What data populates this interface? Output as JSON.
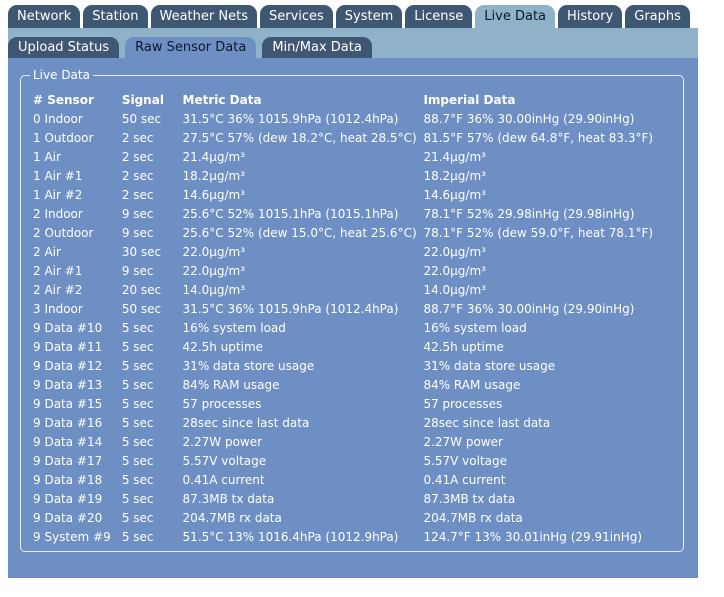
{
  "main_tabs": [
    {
      "label": "Network"
    },
    {
      "label": "Station"
    },
    {
      "label": "Weather Nets"
    },
    {
      "label": "Services"
    },
    {
      "label": "System"
    },
    {
      "label": "License"
    },
    {
      "label": "Live Data"
    },
    {
      "label": "History"
    },
    {
      "label": "Graphs"
    }
  ],
  "sub_tabs": [
    {
      "label": "Upload Status"
    },
    {
      "label": "Raw Sensor Data"
    },
    {
      "label": "Min/Max Data"
    }
  ],
  "live_data": {
    "legend": "Live Data",
    "columns": [
      "# Sensor",
      "Signal",
      "Metric Data",
      "Imperial Data"
    ],
    "rows": [
      [
        "0 Indoor",
        "50 sec",
        "31.5°C 36% 1015.9hPa (1012.4hPa)",
        "88.7°F 36% 30.00inHg (29.90inHg)"
      ],
      [
        "1 Outdoor",
        "2 sec",
        "27.5°C 57% (dew 18.2°C, heat 28.5°C)",
        "81.5°F 57% (dew 64.8°F, heat 83.3°F)"
      ],
      [
        "1 Air",
        "2 sec",
        "21.4µg/m³",
        "21.4µg/m³"
      ],
      [
        "1 Air #1",
        "2 sec",
        "18.2µg/m³",
        "18.2µg/m³"
      ],
      [
        "1 Air #2",
        "2 sec",
        "14.6µg/m³",
        "14.6µg/m³"
      ],
      [
        "2 Indoor",
        "9 sec",
        "25.6°C 52% 1015.1hPa (1015.1hPa)",
        "78.1°F 52% 29.98inHg (29.98inHg)"
      ],
      [
        "2 Outdoor",
        "9 sec",
        "25.6°C 52% (dew 15.0°C, heat 25.6°C)",
        "78.1°F 52% (dew 59.0°F, heat 78.1°F)"
      ],
      [
        "2 Air",
        "30 sec",
        "22.0µg/m³",
        "22.0µg/m³"
      ],
      [
        "2 Air #1",
        "9 sec",
        "22.0µg/m³",
        "22.0µg/m³"
      ],
      [
        "2 Air #2",
        "20 sec",
        "14.0µg/m³",
        "14.0µg/m³"
      ],
      [
        "3 Indoor",
        "50 sec",
        "31.5°C 36% 1015.9hPa (1012.4hPa)",
        "88.7°F 36% 30.00inHg (29.90inHg)"
      ],
      [
        "9 Data #10",
        "5 sec",
        "16% system load",
        "16% system load"
      ],
      [
        "9 Data #11",
        "5 sec",
        "42.5h uptime",
        "42.5h uptime"
      ],
      [
        "9 Data #12",
        "5 sec",
        "31% data store usage",
        "31% data store usage"
      ],
      [
        "9 Data #13",
        "5 sec",
        "84% RAM usage",
        "84% RAM usage"
      ],
      [
        "9 Data #15",
        "5 sec",
        "57 processes",
        "57 processes"
      ],
      [
        "9 Data #16",
        "5 sec",
        "28sec since last data",
        "28sec since last data"
      ],
      [
        "9 Data #14",
        "5 sec",
        "2.27W power",
        "2.27W power"
      ],
      [
        "9 Data #17",
        "5 sec",
        "5.57V voltage",
        "5.57V voltage"
      ],
      [
        "9 Data #18",
        "5 sec",
        "0.41A current",
        "0.41A current"
      ],
      [
        "9 Data #19",
        "5 sec",
        "87.3MB tx data",
        "87.3MB tx data"
      ],
      [
        "9 Data #20",
        "5 sec",
        "204.7MB rx data",
        "204.7MB rx data"
      ],
      [
        "9 System #9",
        "5 sec",
        "51.5°C 13% 1016.4hPa (1012.9hPa)",
        "124.7°F 13% 30.01inHg (29.91inHg)"
      ]
    ]
  },
  "colors": {
    "tab_bg": "#3e5873",
    "active_tab_bg": "#8fb2c9",
    "panel_bg": "#6e8fc3"
  }
}
